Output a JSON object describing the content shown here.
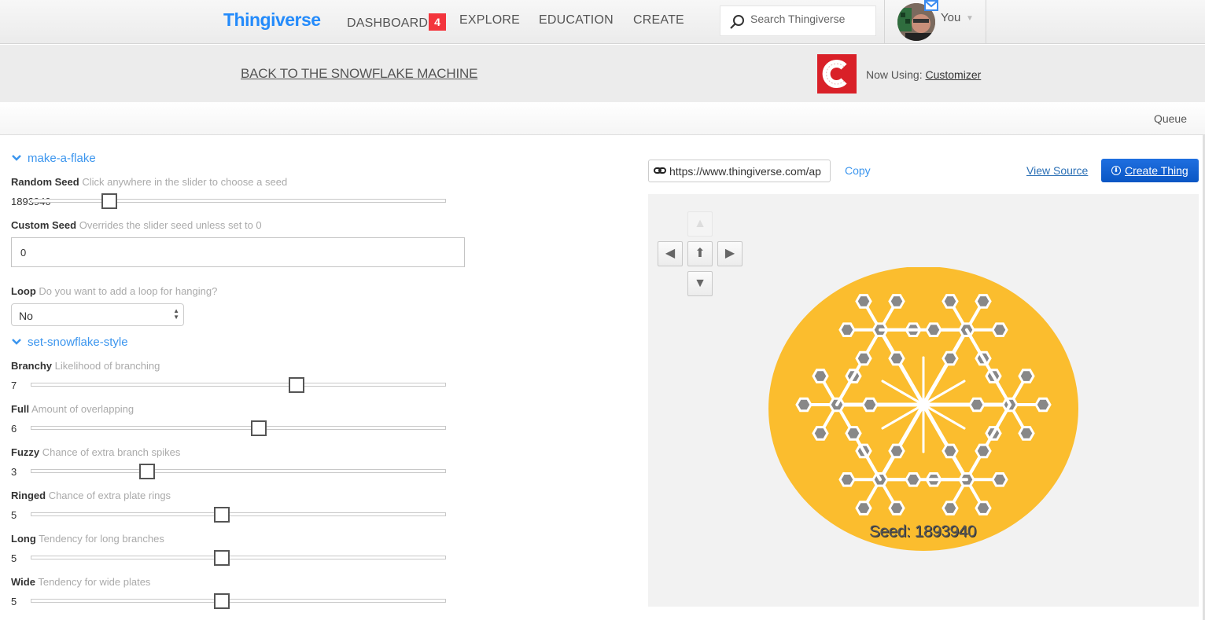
{
  "nav": {
    "logo": "Thingiverse",
    "links": [
      {
        "label": "DASHBOARD",
        "badge": "4"
      },
      {
        "label": "EXPLORE"
      },
      {
        "label": "EDUCATION"
      },
      {
        "label": "CREATE"
      }
    ],
    "search_placeholder": "Search Thingiverse",
    "user_label": "You",
    "brand_color": "#248bfb",
    "badge_color": "#f3353d"
  },
  "subheader": {
    "back_link": "BACK TO THE SNOWFLAKE MACHINE",
    "now_using_label": "Now Using:",
    "app_name": "Customizer",
    "app_icon": "customizer-c-icon"
  },
  "queue_label": "Queue",
  "params": {
    "sections": [
      {
        "title": "make-a-flake"
      },
      {
        "title": "set-snowflake-style"
      }
    ],
    "random_seed": {
      "label": "Random Seed",
      "desc": "Click anywhere in the slider to choose a seed",
      "value": "1893940",
      "fraction": 0.19
    },
    "custom_seed": {
      "label": "Custom Seed",
      "desc": "Overrides the slider seed unless set to 0",
      "value": "0"
    },
    "loop": {
      "label": "Loop",
      "desc": "Do you want to add a loop for hanging?",
      "value": "No"
    },
    "sliders": [
      {
        "label": "Branchy",
        "desc": "Likelihood of branching",
        "value": "7",
        "fraction": 0.64
      },
      {
        "label": "Full",
        "desc": "Amount of overlapping",
        "value": "6",
        "fraction": 0.55
      },
      {
        "label": "Fuzzy",
        "desc": "Chance of extra branch spikes",
        "value": "3",
        "fraction": 0.28
      },
      {
        "label": "Ringed",
        "desc": "Chance of extra plate rings",
        "value": "5",
        "fraction": 0.46
      },
      {
        "label": "Long",
        "desc": "Tendency for long branches",
        "value": "5",
        "fraction": 0.46
      },
      {
        "label": "Wide",
        "desc": "Tendency for wide plates",
        "value": "5",
        "fraction": 0.46
      }
    ]
  },
  "preview": {
    "share_url": "https://www.thingiverse.com/ap",
    "copy_label": "Copy",
    "view_source_label": "View Source",
    "create_label": "Create Thing",
    "seed_text": "Seed: 1893940",
    "disc_color": "#fbbd2e",
    "accent_button_color": "#0a5fd0",
    "nav_controls": [
      "up",
      "left",
      "home",
      "right",
      "down"
    ]
  }
}
